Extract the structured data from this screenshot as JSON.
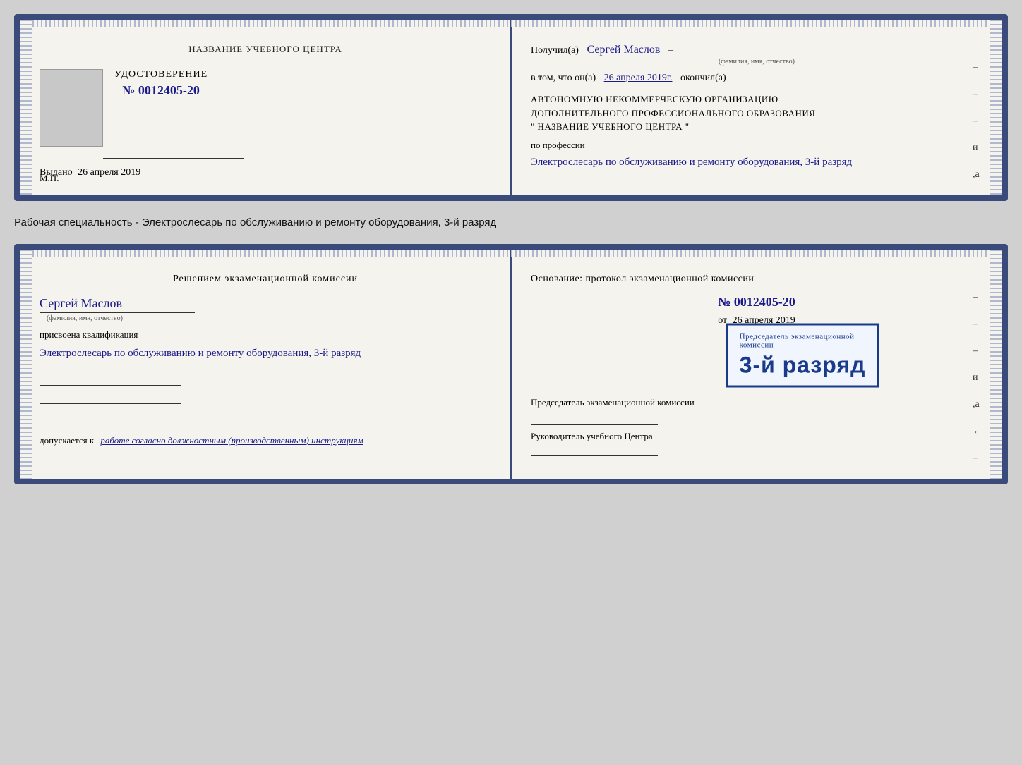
{
  "card1": {
    "left": {
      "center_title": "НАЗВАНИЕ УЧЕБНОГО ЦЕНТРА",
      "photo_alt": "фото",
      "cert_label": "УДОСТОВЕРЕНИЕ",
      "cert_number": "№ 0012405-20",
      "issued_label": "Выдано",
      "issued_date": "26 апреля 2019",
      "mp": "М.П."
    },
    "right": {
      "received_prefix": "Получил(а)",
      "recipient_name": "Сергей Маслов",
      "fio_label": "(фамилия, имя, отчество)",
      "date_prefix": "в том, что он(а)",
      "date_value": "26 апреля 2019г.",
      "finished_label": "окончил(а)",
      "org_line1": "АВТОНОМНУЮ НЕКОММЕРЧЕСКУЮ ОРГАНИЗАЦИЮ",
      "org_line2": "ДОПОЛНИТЕЛЬНОГО ПРОФЕССИОНАЛЬНОГО ОБРАЗОВАНИЯ",
      "org_line3": "\"   НАЗВАНИЕ УЧЕБНОГО ЦЕНТРА   \"",
      "profession_prefix": "по профессии",
      "profession_value": "Электрослесарь по обслуживанию и ремонту оборудования, 3-й разряд"
    }
  },
  "caption": "Рабочая специальность - Электрослесарь по обслуживанию и ремонту оборудования, 3-й разряд",
  "card2": {
    "left": {
      "decision_title": "Решением экзаменационной комиссии",
      "name": "Сергей Маслов",
      "fio_label": "(фамилия, имя, отчество)",
      "qualification_prefix": "присвоена квалификация",
      "qualification_value": "Электрослесарь по обслуживанию и ремонту оборудования, 3-й разряд",
      "admission_prefix": "допускается к",
      "admission_value": "работе согласно должностным (производственным) инструкциям"
    },
    "right": {
      "basis_label": "Основание: протокол экзаменационной комиссии",
      "protocol_number": "№  0012405-20",
      "date_prefix": "от",
      "date_value": "26 апреля 2019",
      "chairman_label": "Председатель экзаменационной комиссии",
      "director_label": "Руководитель учебного Центра"
    },
    "stamp": {
      "line1": "Председатель экзаменационной",
      "line2": "комиссии",
      "big_text": "3-й разряд"
    },
    "right_dashes": [
      "-",
      "-",
      "-",
      "и",
      ",а",
      "←",
      "-"
    ]
  }
}
